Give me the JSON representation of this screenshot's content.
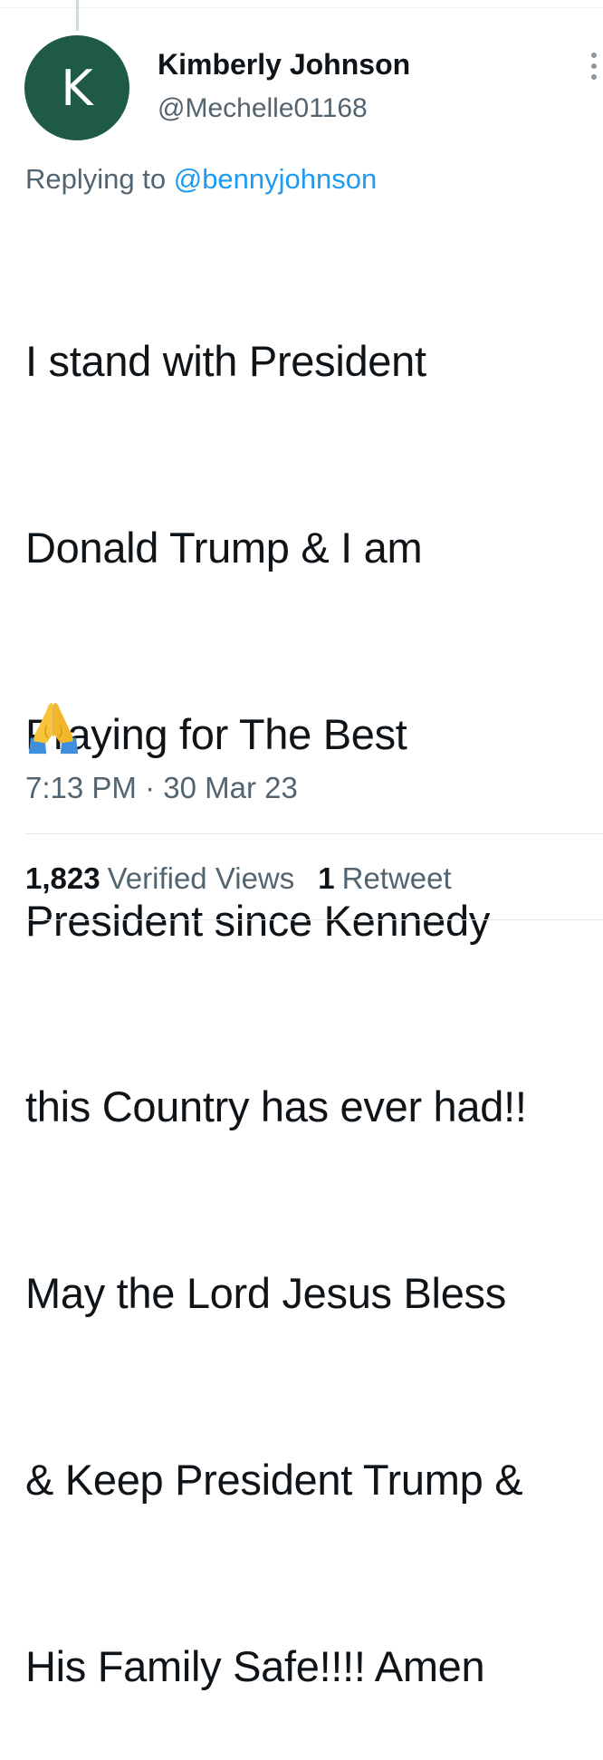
{
  "tweet": {
    "author": {
      "avatar_initial": "K",
      "avatar_color": "#1f5a48",
      "display_name": "Kimberly Johnson",
      "handle": "@Mechelle01168"
    },
    "reply": {
      "prefix": "Replying to ",
      "mention": "@bennyjohnson"
    },
    "text_lines": [
      "I stand with President",
      "Donald Trump & I am",
      "Praying for The Best",
      "President since Kennedy",
      "this Country has ever had!!",
      "May the Lord Jesus Bless",
      "& Keep President Trump &",
      "His Family Safe!!!! Amen"
    ],
    "emoji_icon": "folded-hands-icon",
    "timestamp": "7:13 PM · 30 Mar 23",
    "stats": {
      "views_count": "1,823",
      "views_label": "Verified Views",
      "retweets_count": "1",
      "retweets_label": "Retweet"
    }
  },
  "colors": {
    "text_primary": "#0f1419",
    "text_secondary": "#536471",
    "link": "#1d9bf0"
  }
}
